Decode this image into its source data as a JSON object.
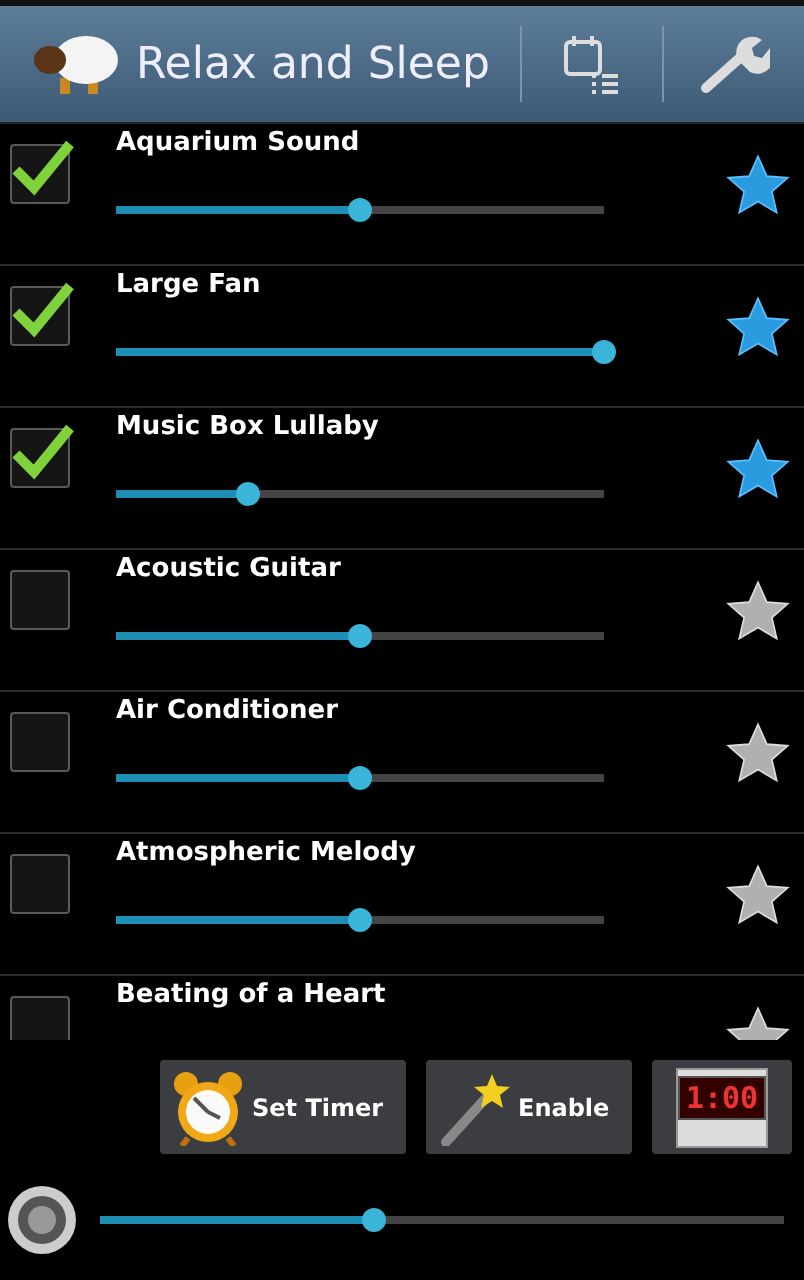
{
  "header": {
    "title": "Relax and Sleep"
  },
  "sounds": [
    {
      "name": "Aquarium Sound",
      "checked": true,
      "level": 0.5,
      "favorite": true
    },
    {
      "name": "Large Fan",
      "checked": true,
      "level": 1.0,
      "favorite": true
    },
    {
      "name": "Music Box Lullaby",
      "checked": true,
      "level": 0.27,
      "favorite": true
    },
    {
      "name": "Acoustic Guitar",
      "checked": false,
      "level": 0.5,
      "favorite": false
    },
    {
      "name": "Air Conditioner",
      "checked": false,
      "level": 0.5,
      "favorite": false
    },
    {
      "name": "Atmospheric Melody",
      "checked": false,
      "level": 0.5,
      "favorite": false
    },
    {
      "name": "Beating of a Heart",
      "checked": false,
      "favorite": false
    }
  ],
  "buttons": [
    {
      "kind": "timer",
      "label": "Set Timer"
    },
    {
      "kind": "enable",
      "label": "Enable"
    },
    {
      "kind": "clock",
      "label": "1:00"
    }
  ],
  "volume": {
    "level": 0.4
  }
}
